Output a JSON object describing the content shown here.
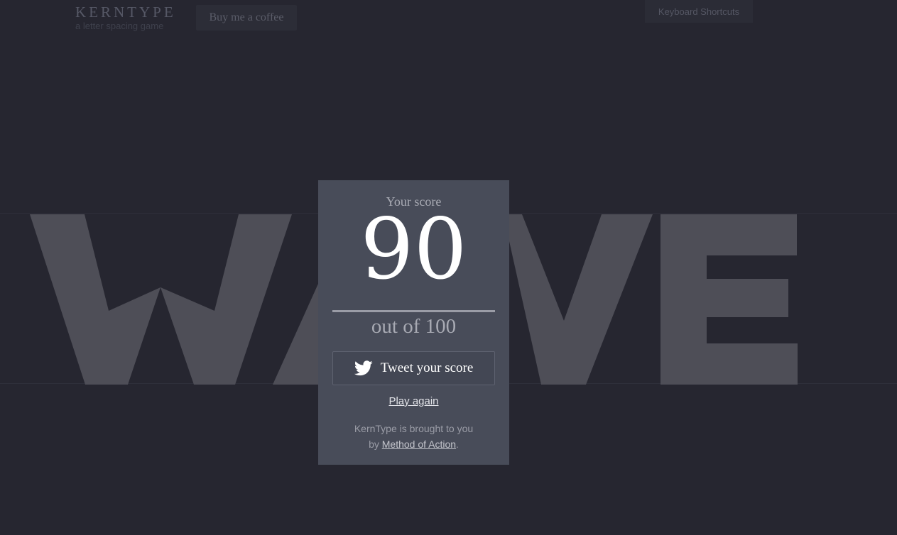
{
  "header": {
    "logo_title": "KERNTYPE",
    "logo_subtitle": "a letter spacing game",
    "coffee_button": "Buy me a coffee",
    "shortcuts_button": "Keyboard Shortcuts"
  },
  "puzzle": {
    "word": "WAVE",
    "glyph_color": "#4e4e57"
  },
  "score_card": {
    "caption": "Your score",
    "score": "90",
    "total": "out of 100",
    "tweet_label": "Tweet your score",
    "play_again": "Play again",
    "credits_line1": "KernType is brought to you",
    "credits_by": "by ",
    "credits_link": "Method of Action",
    "credits_end": "."
  },
  "icons": {
    "tweet": "twitter-bird-icon"
  },
  "colors": {
    "background": "#262630",
    "card": "#484c59",
    "text_primary": "#ffffff"
  }
}
